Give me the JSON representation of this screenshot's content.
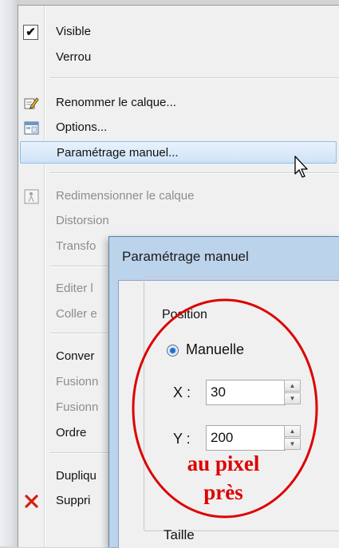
{
  "menu": {
    "items": [
      {
        "label": "Visible",
        "checked": true,
        "enabled": true
      },
      {
        "label": "Verrou",
        "enabled": true
      },
      {
        "label": "Renommer le calque...",
        "icon": "rename-pencil-icon",
        "enabled": true
      },
      {
        "label": "Options...",
        "icon": "options-window-icon",
        "enabled": true
      },
      {
        "label": "Paramétrage manuel...",
        "enabled": true,
        "highlighted": true
      },
      {
        "label": "Redimensionner le calque",
        "icon": "resize-layer-icon",
        "enabled": false
      },
      {
        "label": "Distorsion",
        "enabled": false
      },
      {
        "label": "Transfo",
        "enabled": false
      },
      {
        "label": "Editer l",
        "enabled": false
      },
      {
        "label": "Coller e",
        "enabled": false
      },
      {
        "label": "Conver",
        "enabled": true
      },
      {
        "label": "Fusionn",
        "enabled": false
      },
      {
        "label": "Fusionn",
        "enabled": false
      },
      {
        "label": "Ordre",
        "enabled": true
      },
      {
        "label": "Dupliqu",
        "enabled": true
      },
      {
        "label": "Suppri",
        "icon": "delete-x-icon",
        "enabled": true
      }
    ]
  },
  "dialog": {
    "title": "Paramétrage manuel",
    "position_group": "Position",
    "mode_label": "Manuelle",
    "x_label": "X :",
    "x_value": "30",
    "y_label": "Y :",
    "y_value": "200",
    "size_group": "Taille"
  },
  "annotation": {
    "line1": "au pixel",
    "line2": "près",
    "color": "#dd0000"
  },
  "colors": {
    "highlight": "#cfe3f7",
    "dialog_frame": "#bcd3ec"
  }
}
